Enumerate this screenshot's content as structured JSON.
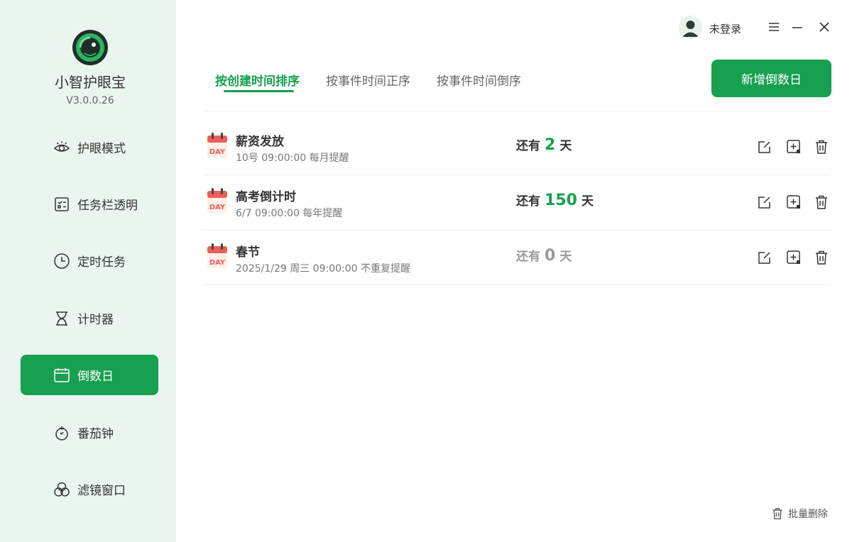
{
  "app": {
    "name": "小智护眼宝",
    "version": "V3.0.0.26"
  },
  "user": {
    "name": "未登录"
  },
  "sidebar": {
    "items": [
      {
        "label": "护眼模式",
        "icon": "eye-icon",
        "active": false
      },
      {
        "label": "任务栏透明",
        "icon": "taskbar-icon",
        "active": false
      },
      {
        "label": "定时任务",
        "icon": "clock-icon",
        "active": false
      },
      {
        "label": "计时器",
        "icon": "hourglass-icon",
        "active": false
      },
      {
        "label": "倒数日",
        "icon": "calendar-icon",
        "active": true
      },
      {
        "label": "番茄钟",
        "icon": "tomato-icon",
        "active": false
      },
      {
        "label": "滤镜窗口",
        "icon": "filter-icon",
        "active": false
      }
    ]
  },
  "tabs": [
    {
      "label": "按创建时间排序",
      "active": true
    },
    {
      "label": "按事件时间正序",
      "active": false
    },
    {
      "label": "按事件时间倒序",
      "active": false
    }
  ],
  "add_button": "新增倒数日",
  "events": [
    {
      "title": "薪资发放",
      "subtitle": "10号 09:00:00 每月提醒",
      "prefix": "还有",
      "days": "2",
      "suffix": "天",
      "expired": false
    },
    {
      "title": "高考倒计时",
      "subtitle": "6/7 09:00:00 每年提醒",
      "prefix": "还有",
      "days": "150",
      "suffix": "天",
      "expired": false
    },
    {
      "title": "春节",
      "subtitle": "2025/1/29 周三 09:00:00 不重复提醒",
      "prefix": "还有",
      "days": "0",
      "suffix": "天",
      "expired": true
    }
  ],
  "calendar_icon_text": "DAY",
  "batch_delete": "批量删除",
  "colors": {
    "accent": "#16a04f",
    "sidebar_bg": "#e9f5ee",
    "muted": "#999999"
  }
}
